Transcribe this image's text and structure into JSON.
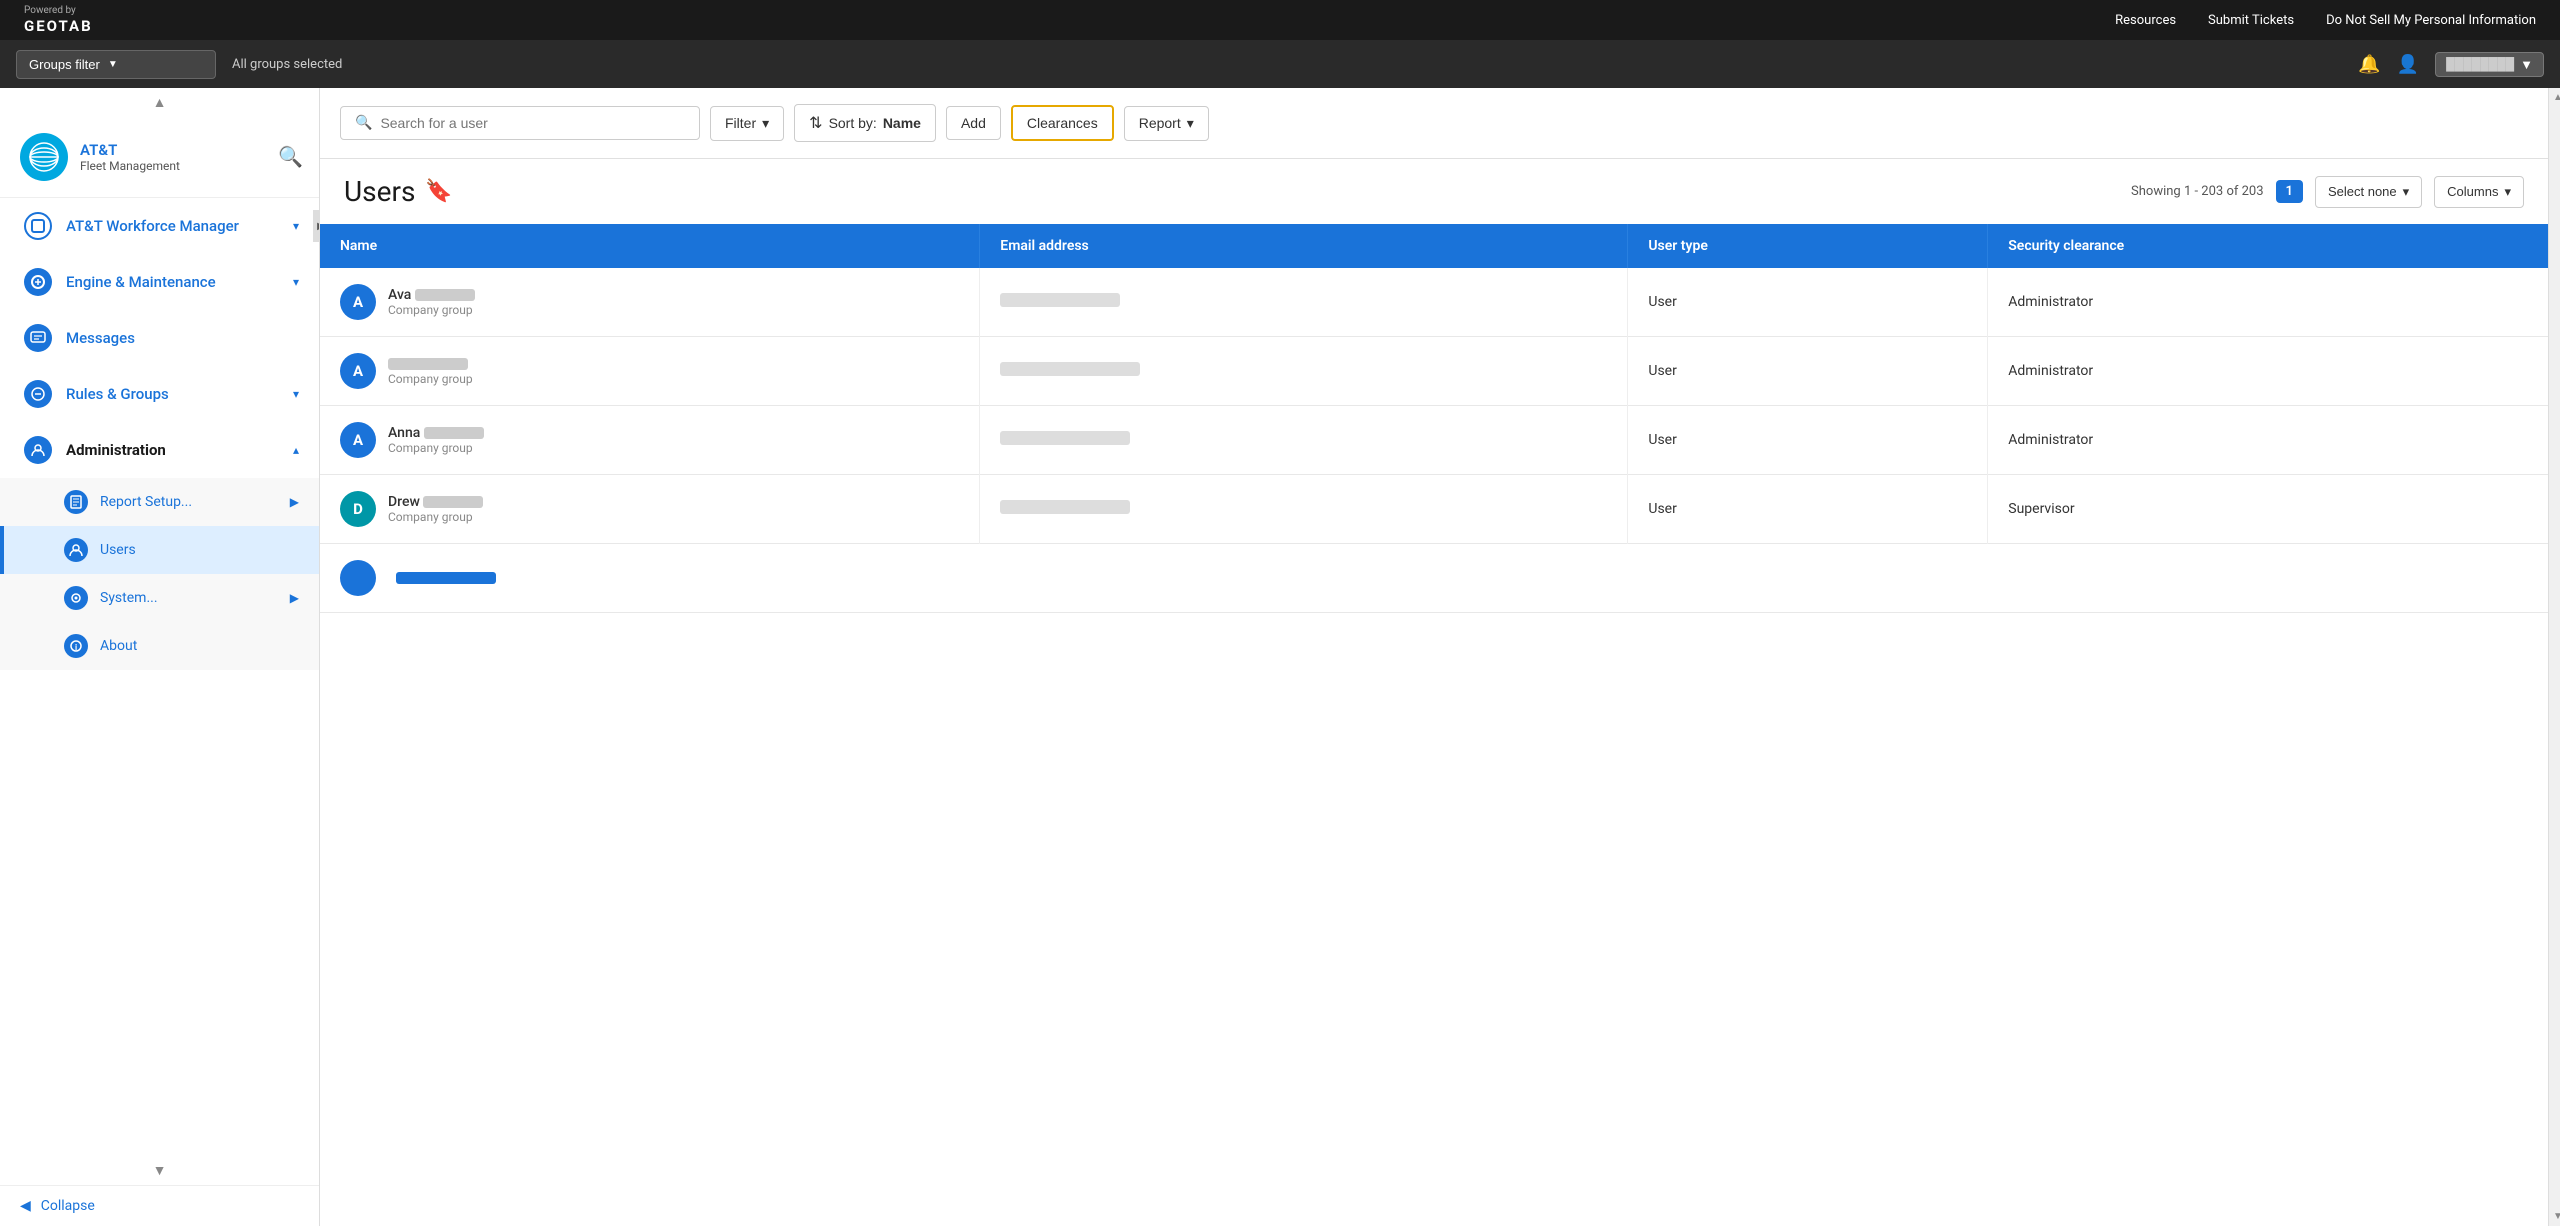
{
  "topNav": {
    "poweredBy": "Powered by",
    "brand": "GEOTAB",
    "links": [
      "Resources",
      "Submit Tickets",
      "Do Not Sell My Personal Information"
    ]
  },
  "groupsBar": {
    "filterLabel": "Groups filter",
    "selectedLabel": "All groups selected",
    "bellIcon": "🔔",
    "userIcon": "👤"
  },
  "sidebar": {
    "appName": "AT&T",
    "appSubtitle": "Fleet Management",
    "navItems": [
      {
        "id": "att-workforce",
        "label": "AT&T Workforce Manager",
        "hasChevron": true
      },
      {
        "id": "engine-maintenance",
        "label": "Engine & Maintenance",
        "hasChevron": true
      },
      {
        "id": "messages",
        "label": "Messages",
        "hasChevron": false
      },
      {
        "id": "rules-groups",
        "label": "Rules & Groups",
        "hasChevron": true
      },
      {
        "id": "administration",
        "label": "Administration",
        "hasChevron": true,
        "isExpanded": true
      }
    ],
    "subItems": [
      {
        "id": "report-setup",
        "label": "Report Setup...",
        "hasArrow": true
      },
      {
        "id": "users",
        "label": "Users",
        "isActive": true
      },
      {
        "id": "system",
        "label": "System...",
        "hasArrow": true
      },
      {
        "id": "about",
        "label": "About"
      }
    ],
    "collapseLabel": "Collapse"
  },
  "toolbar": {
    "searchPlaceholder": "Search for a user",
    "filterLabel": "Filter",
    "sortLabel": "Sort by:",
    "sortValue": "Name",
    "addLabel": "Add",
    "clearancesLabel": "Clearances",
    "reportLabel": "Report"
  },
  "usersSection": {
    "title": "Users",
    "showingText": "Showing 1 - 203 of 203",
    "pageNumber": "1",
    "selectNoneLabel": "Select none",
    "columnsLabel": "Columns",
    "tableHeaders": [
      "Name",
      "Email address",
      "User type",
      "Security clearance"
    ],
    "rows": [
      {
        "id": "ava",
        "initial": "A",
        "firstName": "Ava",
        "lastName": "██████",
        "group": "Company group",
        "emailWidth": 120,
        "userType": "User",
        "securityClearance": "Administrator",
        "avatarColor": "blue"
      },
      {
        "id": "a2",
        "initial": "A",
        "firstName": "",
        "lastName": "████████",
        "group": "Company group",
        "emailWidth": 140,
        "userType": "User",
        "securityClearance": "Administrator",
        "avatarColor": "blue"
      },
      {
        "id": "anna",
        "initial": "A",
        "firstName": "Anna",
        "lastName": "████",
        "group": "Company group",
        "emailWidth": 130,
        "userType": "User",
        "securityClearance": "Administrator",
        "avatarColor": "blue"
      },
      {
        "id": "drew",
        "initial": "D",
        "firstName": "Drew",
        "lastName": "████",
        "group": "Company group",
        "emailWidth": 130,
        "userType": "User",
        "securityClearance": "Supervisor",
        "avatarColor": "teal"
      }
    ]
  }
}
